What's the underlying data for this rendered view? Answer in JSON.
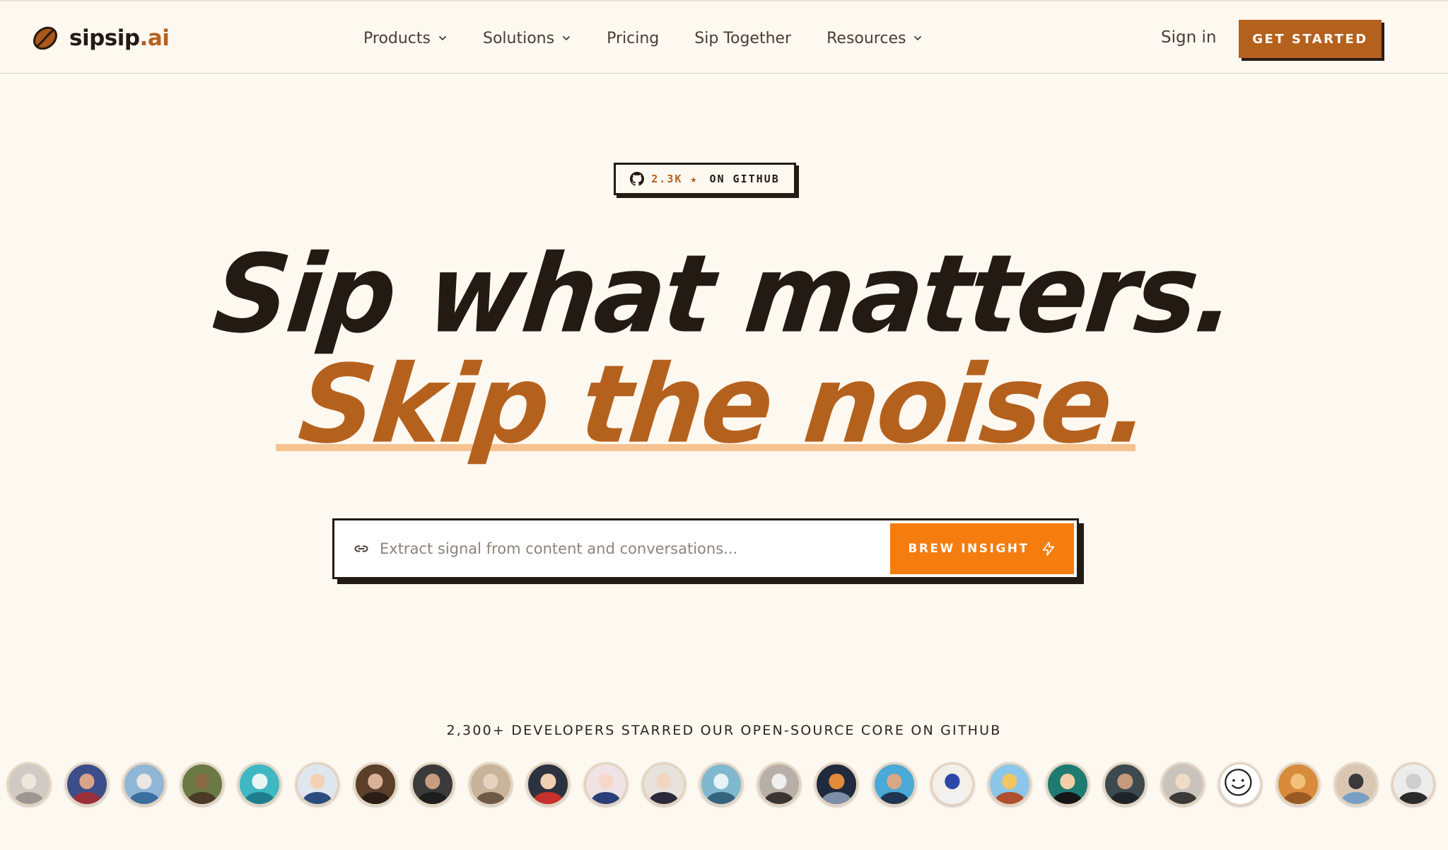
{
  "nav": {
    "logo_main": "sipsip",
    "logo_ext": ".ai",
    "items": [
      {
        "label": "Products",
        "has_dropdown": true
      },
      {
        "label": "Solutions",
        "has_dropdown": true
      },
      {
        "label": "Pricing",
        "has_dropdown": false
      },
      {
        "label": "Sip Together",
        "has_dropdown": false
      },
      {
        "label": "Resources",
        "has_dropdown": true
      }
    ],
    "sign_in": "Sign in",
    "get_started": "GET STARTED"
  },
  "badge": {
    "stars": "2.3K ★",
    "label": "ON GITHUB"
  },
  "hero": {
    "line1": "Sip what matters.",
    "line2": "Skip the noise."
  },
  "search": {
    "placeholder": "Extract signal from content and conversations...",
    "value": "",
    "button": "BREW INSIGHT"
  },
  "proof": {
    "text": "2,300+ DEVELOPERS STARRED OUR OPEN-SOURCE CORE ON GITHUB"
  },
  "colors": {
    "brand": "#b5611e",
    "accent": "#f57c0f",
    "background": "#fdf8f0",
    "ink": "#241a14",
    "underline": "#f6c28f"
  },
  "avatars": [
    {
      "bg": "#cfcac4",
      "face": "#efe6dc",
      "body": "#9e9790"
    },
    {
      "bg": "#3b4e8a",
      "face": "#d9a38a",
      "body": "#9b2f3a"
    },
    {
      "bg": "#8fb6d6",
      "face": "#eae6e1",
      "body": "#3c6fa1"
    },
    {
      "bg": "#6b7a45",
      "face": "#8a6a45",
      "body": "#4b3a28"
    },
    {
      "bg": "#3fb8c4",
      "face": "#e9f6f4",
      "body": "#1f7e8c"
    },
    {
      "bg": "#dfe6ee",
      "face": "#f4d3b5",
      "body": "#2c4c7f"
    },
    {
      "bg": "#5b3f2b",
      "face": "#d9b196",
      "body": "#2a1d15"
    },
    {
      "bg": "#3a3a3a",
      "face": "#c99c80",
      "body": "#1e1e1e"
    },
    {
      "bg": "#c9b39a",
      "face": "#e5d2bf",
      "body": "#6f5a47"
    },
    {
      "bg": "#2d3240",
      "face": "#f1d0b1",
      "body": "#c7302b"
    },
    {
      "bg": "#f0e3e6",
      "face": "#f6d8c8",
      "body": "#2a3f7a"
    },
    {
      "bg": "#e8e2dc",
      "face": "#f1d6c4",
      "body": "#2a2a3a"
    },
    {
      "bg": "#7fb8cf",
      "face": "#e6f3f7",
      "body": "#35657e"
    },
    {
      "bg": "#b8b0a8",
      "face": "#efefef",
      "body": "#3a3532"
    },
    {
      "bg": "#1f2a3d",
      "face": "#e28b3c",
      "body": "#7d8fa8"
    },
    {
      "bg": "#4aa9d7",
      "face": "#d8a787",
      "body": "#1f3552"
    },
    {
      "bg": "#f3efe9",
      "face": "#2d47a8",
      "body": "#f2f2f2"
    },
    {
      "bg": "#8cc6e8",
      "face": "#f2c660",
      "body": "#b04f2f"
    },
    {
      "bg": "#1f7a72",
      "face": "#f2cfa6",
      "body": "#161616"
    },
    {
      "bg": "#3c4a4f",
      "face": "#c79a7c",
      "body": "#1e2428"
    },
    {
      "bg": "#c9c3bb",
      "face": "#efdcc4",
      "body": "#3b3a38"
    },
    {
      "bg": "#ffffff",
      "face": "#ffffff",
      "body": "#ffffff"
    },
    {
      "bg": "#d88b3a",
      "face": "#f2c07a",
      "body": "#9a5a24"
    },
    {
      "bg": "#d9c7b4",
      "face": "#3a3a3a",
      "body": "#7a9fc4"
    },
    {
      "bg": "#ececec",
      "face": "#cfcfcf",
      "body": "#2c2c2c"
    }
  ]
}
